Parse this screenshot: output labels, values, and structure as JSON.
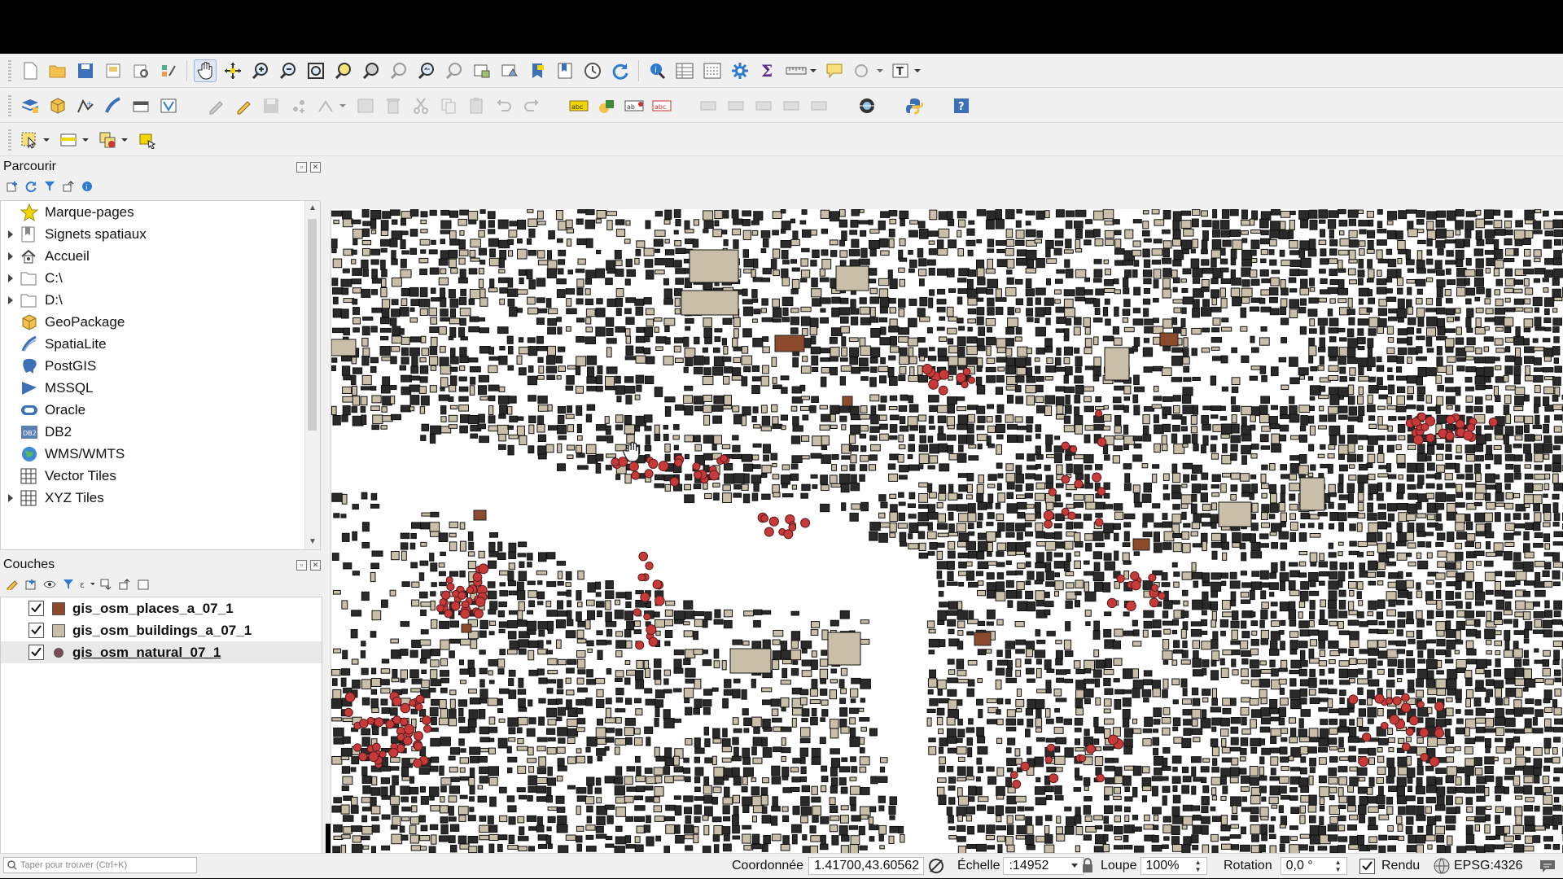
{
  "browser_panel": {
    "title": "Parcourir",
    "items": [
      {
        "label": "Marque-pages",
        "icon": "star-icon",
        "expandable": false
      },
      {
        "label": "Signets spatiaux",
        "icon": "spatial-bookmark-icon",
        "expandable": true
      },
      {
        "label": "Accueil",
        "icon": "home-icon",
        "expandable": true
      },
      {
        "label": "C:\\",
        "icon": "folder-icon",
        "expandable": true
      },
      {
        "label": "D:\\",
        "icon": "folder-icon",
        "expandable": true
      },
      {
        "label": "GeoPackage",
        "icon": "geopackage-icon",
        "expandable": false
      },
      {
        "label": "SpatiaLite",
        "icon": "spatialite-icon",
        "expandable": false
      },
      {
        "label": "PostGIS",
        "icon": "postgis-icon",
        "expandable": false
      },
      {
        "label": "MSSQL",
        "icon": "mssql-icon",
        "expandable": false
      },
      {
        "label": "Oracle",
        "icon": "oracle-icon",
        "expandable": false
      },
      {
        "label": "DB2",
        "icon": "db2-icon",
        "expandable": false
      },
      {
        "label": "WMS/WMTS",
        "icon": "globe-icon",
        "expandable": false
      },
      {
        "label": "Vector Tiles",
        "icon": "grid-icon",
        "expandable": false
      },
      {
        "label": "XYZ Tiles",
        "icon": "grid-icon",
        "expandable": true
      }
    ]
  },
  "layers_panel": {
    "title": "Couches",
    "layers": [
      {
        "name": "gis_osm_places_a_07_1",
        "checked": true,
        "color": "#8b4a2b",
        "kind": "polygon"
      },
      {
        "name": "gis_osm_buildings_a_07_1",
        "checked": true,
        "color": "#c9bfa8",
        "kind": "polygon"
      },
      {
        "name": "gis_osm_natural_07_1",
        "checked": true,
        "color": "#7a4a55",
        "kind": "point"
      }
    ]
  },
  "colors": {
    "buildings_outline": "#111111",
    "buildings_fill": "#c9bfa8",
    "places_fill": "#8b4a2b",
    "natural_points": "#c83a3a",
    "map_background": "#ffffff"
  },
  "statusbar": {
    "search_placeholder": "Taper pour trouver (Ctrl+K)",
    "coordinate_label": "Coordonnée",
    "coordinate_value": "1.41700,43.60562",
    "scale_label": "Échelle",
    "scale_value": ":14952",
    "magnifier_label": "Loupe",
    "magnifier_value": "100%",
    "rotation_label": "Rotation",
    "rotation_value": "0,0 °",
    "render_label": "Rendu",
    "render_checked": true,
    "crs": "EPSG:4326"
  }
}
